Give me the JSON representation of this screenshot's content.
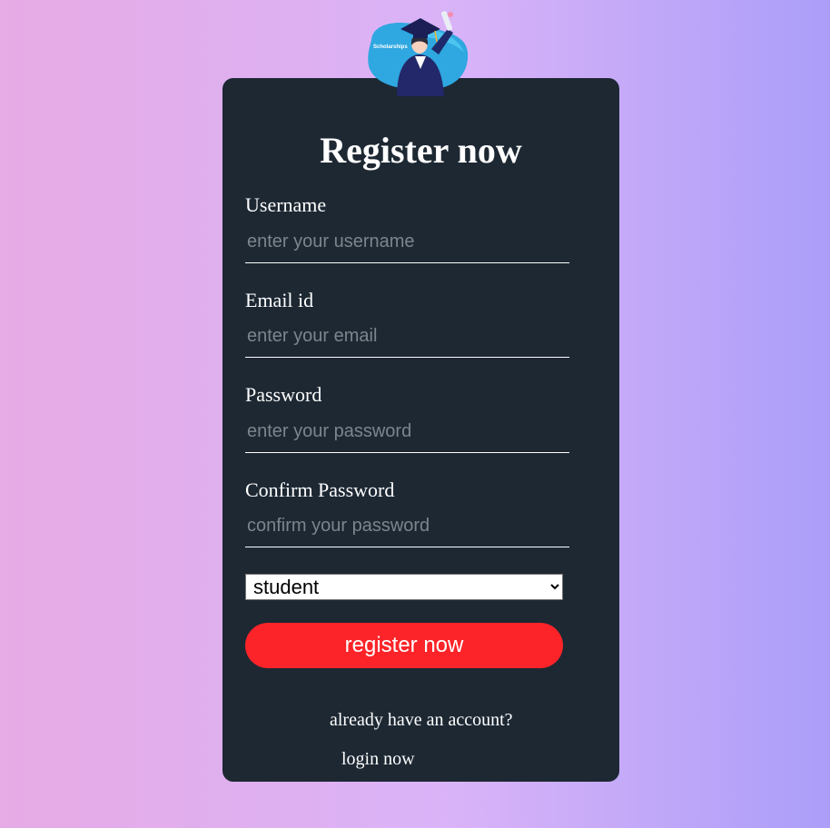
{
  "page": {
    "background_gradient": [
      "#e7abe5",
      "#d9b3f8",
      "#ab9ef9"
    ]
  },
  "logo": {
    "text": "Scholarships",
    "icon": "graduate-illustration"
  },
  "form": {
    "title": "Register now",
    "background_color": "#1d2833",
    "fields": [
      {
        "label": "Username",
        "placeholder": "enter your username",
        "value": ""
      },
      {
        "label": "Email id",
        "placeholder": "enter your email",
        "value": ""
      },
      {
        "label": "Password",
        "placeholder": "enter your password",
        "value": ""
      },
      {
        "label": "Confirm Password",
        "placeholder": "confirm your password",
        "value": ""
      }
    ],
    "role_select": {
      "selected": "student",
      "icon": "chevron-down-icon"
    },
    "submit_label": "register now",
    "submit_color": "#fc2428",
    "already_text": "already have an account?",
    "login_label": "login now"
  }
}
